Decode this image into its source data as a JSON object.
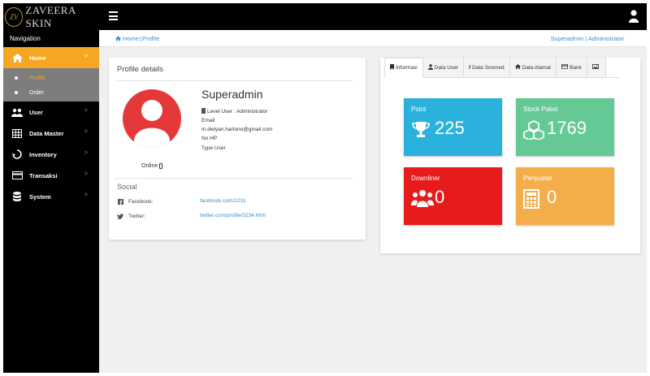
{
  "brand": {
    "logo_text": "ZV",
    "name": "ZAVEERA SKIN"
  },
  "sidebar": {
    "title": "Navigation",
    "items": [
      {
        "label": "Home",
        "icon": "home-icon",
        "chevron": ">"
      },
      {
        "label": "User",
        "icon": "users-icon",
        "chevron": ">"
      },
      {
        "label": "Data Master",
        "icon": "table-icon",
        "chevron": ">"
      },
      {
        "label": "Inventory",
        "icon": "recycle-icon",
        "chevron": ">"
      },
      {
        "label": "Transaksi",
        "icon": "credit-card-icon",
        "chevron": ">"
      },
      {
        "label": "System",
        "icon": "database-icon",
        "chevron": ">"
      }
    ],
    "submenu": [
      {
        "label": "Profile"
      },
      {
        "label": "Order"
      }
    ]
  },
  "breadcrumb": {
    "home": "Home",
    "separator": "|",
    "current": "Profile"
  },
  "account": {
    "label": "Superadmin | Administrator"
  },
  "profile": {
    "card_title": "Profile details",
    "name": "Superadmin",
    "level": "Level User : Administrator",
    "email_label": "Email",
    "email": "m.dwiyan.hartono@gmail.com",
    "phone_label": "No HP",
    "type_label": "Type User",
    "status": "Online"
  },
  "social": {
    "title": "Social",
    "facebook_label": "Facebook:",
    "facebook_link": "facebook.com/1231",
    "twitter_label": "Twitter:",
    "twitter_link": "twitter.com/profile/3234.html"
  },
  "tabs": [
    {
      "label": "Informasi",
      "icon": "bookmark-icon"
    },
    {
      "label": "Data User",
      "icon": "user-icon"
    },
    {
      "label": "Data Sosmed",
      "icon": "facebook-icon"
    },
    {
      "label": "Data Alamat",
      "icon": "home-icon"
    },
    {
      "label": "Bank",
      "icon": "credit-card-icon"
    },
    {
      "label": "",
      "icon": "image-icon"
    }
  ],
  "tiles": {
    "point": {
      "label": "Point",
      "value": "225",
      "color": "#2bb2dc"
    },
    "stock": {
      "label": "Stock Paket",
      "value": "1769",
      "color": "#64c994"
    },
    "downliner": {
      "label": "Downliner",
      "value": "0",
      "color": "#e61c1c"
    },
    "penjualan": {
      "label": "Penjualan",
      "value": "0",
      "color": "#f3ae4a"
    }
  },
  "colors": {
    "accent": "#f5a623",
    "link": "#3a8ed0",
    "sidebar_bg": "#000000",
    "submenu_bg": "#7d7d7d"
  }
}
